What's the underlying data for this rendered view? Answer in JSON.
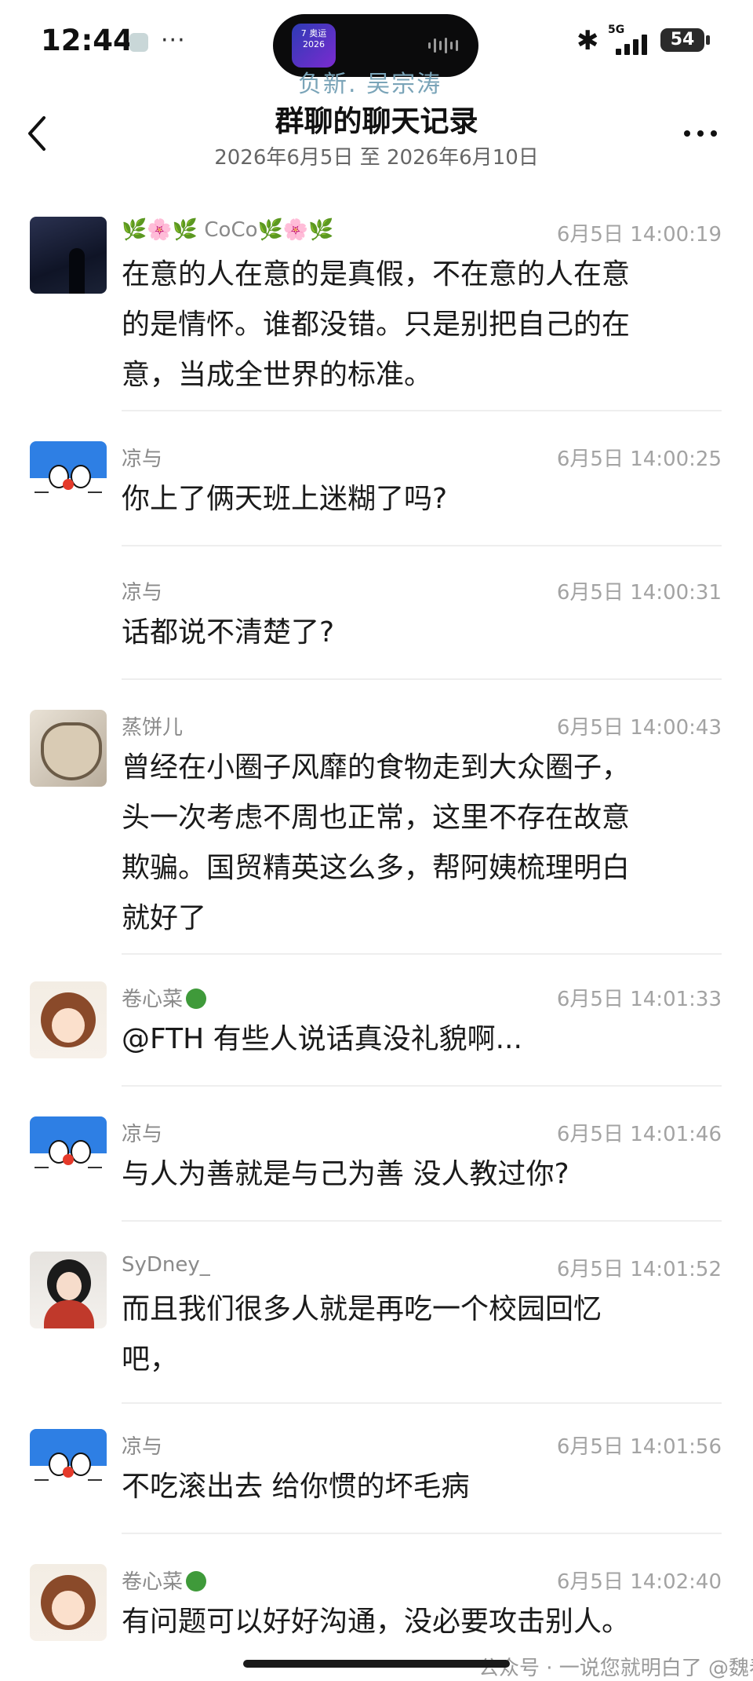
{
  "status_bar": {
    "time": "12:44",
    "more_dots": "···",
    "network": "5G",
    "battery": "54",
    "island_logo_text": "7 奥运 2026",
    "peek_text": "负新. 吴宗涛"
  },
  "header": {
    "title": "群聊的聊天记录",
    "date_range": "2026年6月5日 至 2026年6月10日"
  },
  "messages": [
    {
      "sender": "🌿🌸🌿 CoCo🌿🌸🌿",
      "time": "6月5日 14:00:19",
      "text_lines": [
        "在意的人在意的是真假，不在意的人在意",
        "的是情怀。谁都没错。只是别把自己的在",
        "意，当成全世界的标准。"
      ]
    },
    {
      "sender": "凉与",
      "time": "6月5日 14:00:25",
      "text_lines": [
        "你上了俩天班上迷糊了吗?"
      ]
    },
    {
      "sender": "凉与",
      "time": "6月5日 14:00:31",
      "text_lines": [
        "话都说不清楚了?"
      ]
    },
    {
      "sender": "蒸饼儿",
      "time": "6月5日 14:00:43",
      "text_lines": [
        "曾经在小圈子风靡的食物走到大众圈子，",
        "头一次考虑不周也正常，这里不存在故意",
        "欺骗。国贸精英这么多，帮阿姨梳理明白",
        "就好了"
      ]
    },
    {
      "sender": "卷心菜",
      "time": "6月5日 14:01:33",
      "text_lines": [
        "@FTH 有些人说话真没礼貌啊..."
      ]
    },
    {
      "sender": "凉与",
      "time": "6月5日 14:01:46",
      "text_lines": [
        "与人为善就是与己为善 没人教过你?"
      ]
    },
    {
      "sender": "SyDney_",
      "time": "6月5日 14:01:52",
      "text_lines": [
        "而且我们很多人就是再吃一个校园回忆",
        "吧，"
      ]
    },
    {
      "sender": "凉与",
      "time": "6月5日 14:01:56",
      "text_lines": [
        "不吃滚出去 给你惯的坏毛病"
      ]
    },
    {
      "sender": "卷心菜",
      "time": "6月5日 14:02:40",
      "text_lines": [
        "有问题可以好好沟通，没必要攻击别人。"
      ]
    }
  ],
  "watermark": "公众号 · 一说您就明白了 @魏春亮"
}
